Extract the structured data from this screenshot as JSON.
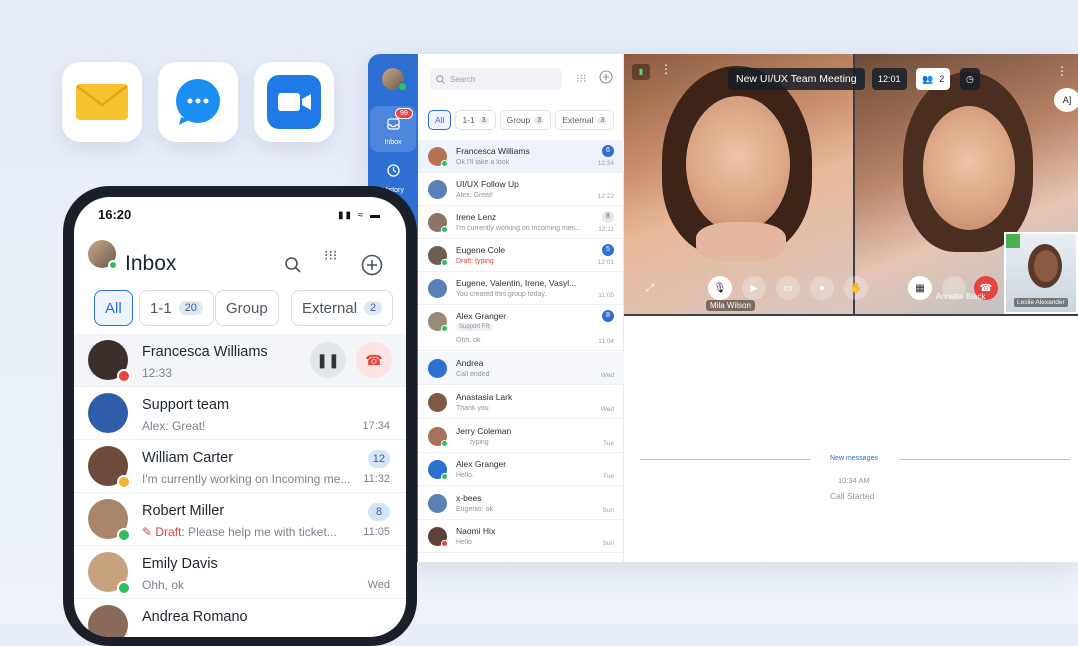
{
  "apps": [
    {
      "name": "mail-app-icon"
    },
    {
      "name": "messenger-app-icon"
    },
    {
      "name": "video-app-icon"
    }
  ],
  "desktop": {
    "rail": {
      "inbox_label": "Inbox",
      "inbox_badge": "99",
      "history_label": "History"
    },
    "search_placeholder": "Search",
    "filters": [
      {
        "label": "All"
      },
      {
        "label": "1-1",
        "count": "3"
      },
      {
        "label": "Group",
        "count": "3"
      },
      {
        "label": "External",
        "count": "3"
      }
    ],
    "chats": [
      {
        "name": "Francesca Williams",
        "preview": "Ok I'll take a look",
        "time": "12:34",
        "badge": "6"
      },
      {
        "name": "UI/UX Follow Up",
        "preview": "Alex: Great!",
        "time": "12:22",
        "badge": ""
      },
      {
        "name": "Irene Lenz",
        "preview": "I'm currently working on Incoming mes...",
        "time": "12:11",
        "badge": "8"
      },
      {
        "name": "Eugene Cole",
        "preview": "Draft: typing",
        "time": "12:01",
        "badge": "5"
      },
      {
        "name": "Eugene, Valentin, Irene, Vasyl...",
        "preview": "You created this group today.",
        "time": "11:05",
        "badge": ""
      },
      {
        "name": "Alex Granger",
        "preview": "Support FR",
        "preview2": "Ohh, ok",
        "time": "11:04",
        "badge": "8"
      },
      {
        "name": "Andrea",
        "preview": "Call ended",
        "time": "Wed",
        "badge": ""
      },
      {
        "name": "Anastasia Lark",
        "preview": "Thank you",
        "time": "Wed",
        "badge": ""
      },
      {
        "name": "Jerry Coleman",
        "preview": "typing",
        "time": "Tue",
        "badge": ""
      },
      {
        "name": "Alex Granger",
        "preview": "Hello.",
        "time": "Tue",
        "badge": ""
      },
      {
        "name": "x-bees",
        "preview": "Eugenio: ok",
        "time": "Sun",
        "badge": ""
      },
      {
        "name": "Naomi Hix",
        "preview": "Hello",
        "time": "Sun",
        "badge": ""
      }
    ],
    "meeting": {
      "title": "New UI/UX Team Meeting",
      "time": "12:01",
      "participants": "2",
      "left_name": "Mila Wilson",
      "right_name": "Annette Black",
      "pip_name": "Leslie Alexander"
    },
    "chat": {
      "new_messages": "New messages",
      "msg_time": "10:34 AM",
      "msg_text": "Call Started"
    }
  },
  "phone": {
    "time": "16:20",
    "title": "Inbox",
    "filters": [
      {
        "label": "All"
      },
      {
        "label": "1-1",
        "count": "20"
      },
      {
        "label": "Group"
      },
      {
        "label": "External",
        "count": "2"
      }
    ],
    "chats": [
      {
        "name": "Francesca Williams",
        "preview": "12:33"
      },
      {
        "name": "Support team",
        "preview": "Alex: Great!",
        "time": "17:34"
      },
      {
        "name": "William Carter",
        "preview": "I'm currently working on Incoming me...",
        "time": "11:32",
        "badge": "12"
      },
      {
        "name": "Robert Miller",
        "preview": "Draft:",
        "preview_rest": "Please help me with ticket...",
        "time": "11:05",
        "badge": "8"
      },
      {
        "name": "Emily Davis",
        "preview": "Ohh, ok",
        "time": "Wed"
      },
      {
        "name": "Andrea Romano",
        "preview": ""
      }
    ]
  }
}
